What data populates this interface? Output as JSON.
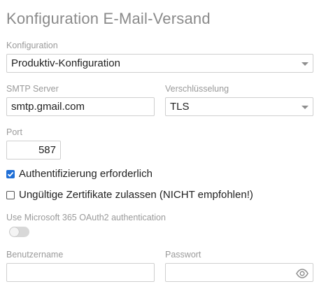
{
  "page": {
    "title": "Konfiguration E-Mail-Versand"
  },
  "konfiguration": {
    "label": "Konfiguration",
    "value": "Produktiv-Konfiguration"
  },
  "smtp": {
    "label": "SMTP Server",
    "value": "smtp.gmail.com"
  },
  "encryption": {
    "label": "Verschlüsselung",
    "value": "TLS"
  },
  "port": {
    "label": "Port",
    "value": "587"
  },
  "auth_required": {
    "label": "Authentifizierung erforderlich",
    "checked": true
  },
  "invalid_certs": {
    "label": "Ungültige Zertifikate zulassen (NICHT empfohlen!)",
    "checked": false
  },
  "oauth": {
    "label": "Use Microsoft 365 OAuth2 authentication",
    "enabled": false
  },
  "username": {
    "label": "Benutzername",
    "value": ""
  },
  "password": {
    "label": "Passwort",
    "value": ""
  },
  "icons": {
    "select_arrow": "caret-down-icon",
    "password_toggle": "eye-icon",
    "checkmark": "checkmark-icon"
  },
  "colors": {
    "accent": "#1f6fd6",
    "label": "#9a9a9a",
    "title": "#8a8a8a"
  }
}
